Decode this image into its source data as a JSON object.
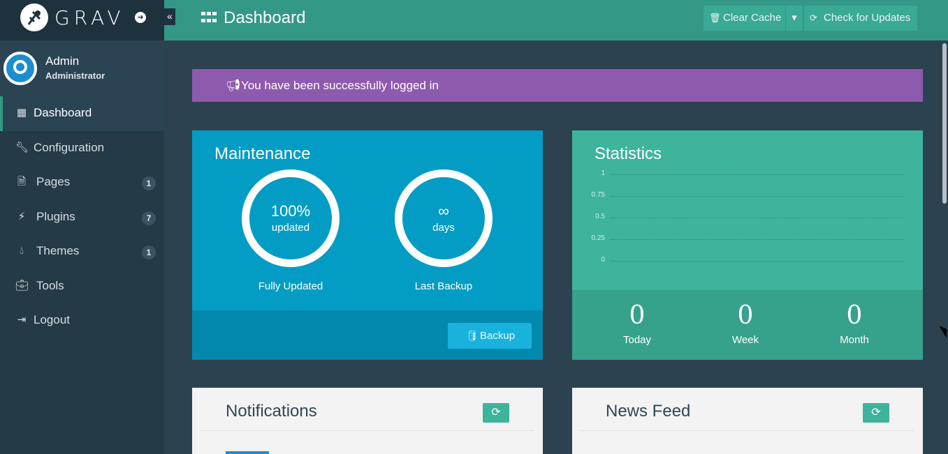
{
  "brand": {
    "logo_text": "GRAV",
    "goto_icon": "arrow-circle-right-icon",
    "collapse_icon": "double-chevron-left-icon"
  },
  "user": {
    "name": "Admin",
    "role": "Administrator"
  },
  "sidebar": {
    "items": [
      {
        "label": "Dashboard",
        "icon": "grid-icon",
        "active": true
      },
      {
        "label": "Configuration",
        "icon": "wrench-icon"
      },
      {
        "label": "Pages",
        "icon": "file-icon",
        "badge": "1"
      },
      {
        "label": "Plugins",
        "icon": "plug-icon",
        "badge": "7"
      },
      {
        "label": "Themes",
        "icon": "tint-icon",
        "badge": "1"
      },
      {
        "label": "Tools",
        "icon": "briefcase-icon"
      },
      {
        "label": "Logout",
        "icon": "sign-out-icon"
      }
    ]
  },
  "topbar": {
    "title": "Dashboard",
    "clear_cache": "Clear Cache",
    "check_updates": "Check for Updates"
  },
  "alert": {
    "message": "You have been successfully logged in",
    "color": "#8e5aae"
  },
  "maintenance": {
    "title": "Maintenance",
    "updated": {
      "value": "100%",
      "unit": "updated",
      "label": "Fully Updated"
    },
    "backup": {
      "value": "∞",
      "unit": "days",
      "label": "Last Backup"
    },
    "backup_button": "Backup"
  },
  "statistics": {
    "title": "Statistics",
    "y_ticks": [
      "1",
      "0.75",
      "0.5",
      "0.25",
      "0"
    ],
    "today": {
      "value": "0",
      "label": "Today"
    },
    "week": {
      "value": "0",
      "label": "Week"
    },
    "month": {
      "value": "0",
      "label": "Month"
    }
  },
  "panels": {
    "notifications": "Notifications",
    "news_feed": "News Feed"
  },
  "colors": {
    "accent": "#349886",
    "maintenance": "#039cc4",
    "statistics": "#3db49b",
    "sidebar": "#253a47"
  }
}
